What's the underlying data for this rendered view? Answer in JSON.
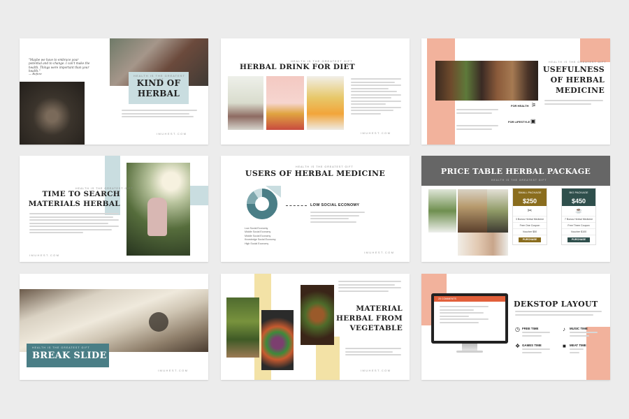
{
  "common": {
    "url": "IMUHEST.COM",
    "kicker": "HEALTH IS THE GREATEST GIFT"
  },
  "colors": {
    "teal": "#4a7e86",
    "light_teal": "#c9dde0",
    "peach": "#f2b29c",
    "sand": "#f3e2a6",
    "olive": "#8a6d1e",
    "dark_green": "#2f4f4c",
    "gray_band": "#666666"
  },
  "slide1": {
    "title_line1": "KIND OF",
    "title_line2": "HERBAL",
    "quote": "\"Maybe we have to embrace your potential and to change. I can't make the health. Things were important than your health.\"",
    "quote_author": "— Before"
  },
  "slide2": {
    "title": "HERBAL DRINK FOR DIET"
  },
  "slide3": {
    "title_line1": "USEFULNESS",
    "title_line2": "OF HERBAL",
    "title_line3": "MEDICINE",
    "label1": "FOR HEALTH",
    "label2": "FOR LIFESTYLE",
    "icon1": "person-icon",
    "icon2": "camera-icon"
  },
  "slide4": {
    "title_line1": "TIME TO SEARCH",
    "title_line2": "MATERIALS HERBAL"
  },
  "slide5": {
    "title": "USERS OF HERBAL MEDICINE",
    "callout": "LOW SOCIAL ECONOMY",
    "legend": [
      "Low Social Economy",
      "Middle Social Economy",
      "Middle Social Economy",
      "Knowledge Social Economy",
      "High Social Economy"
    ]
  },
  "slide6": {
    "title": "PRICE TABLE HERBAL PACKAGE",
    "cards": [
      {
        "name": "SMALL PACKAGE",
        "price": "$250",
        "item1": "3 Bonus Herbal Medicine",
        "item2": "Free One Coupon",
        "item3": "Voucher $50",
        "button": "PURCHASE",
        "icon": "scissors-icon"
      },
      {
        "name": "BIG PACKAGE",
        "price": "$450",
        "item1": "7 Bonus Herbal Medicine",
        "item2": "Free Three Coupon",
        "item3": "Voucher $100",
        "button": "PURCHASE",
        "icon": "cup-icon"
      }
    ]
  },
  "slide7": {
    "title": "BREAK SLIDE"
  },
  "slide8": {
    "title_line1": "MATERIAL",
    "title_line2": "HERBAL FROM",
    "title_line3": "VEGETABLE"
  },
  "slide9": {
    "title": "DEKSTOP LAYOUT",
    "screen_header": "20 COMMENTS",
    "features": [
      {
        "label": "FREE TIME",
        "icon": "clock-icon"
      },
      {
        "label": "MUSIC TIME",
        "icon": "music-icon"
      },
      {
        "label": "GAMES TIME",
        "icon": "puzzle-icon"
      },
      {
        "label": "MEAT TIME",
        "icon": "cow-icon"
      }
    ]
  }
}
